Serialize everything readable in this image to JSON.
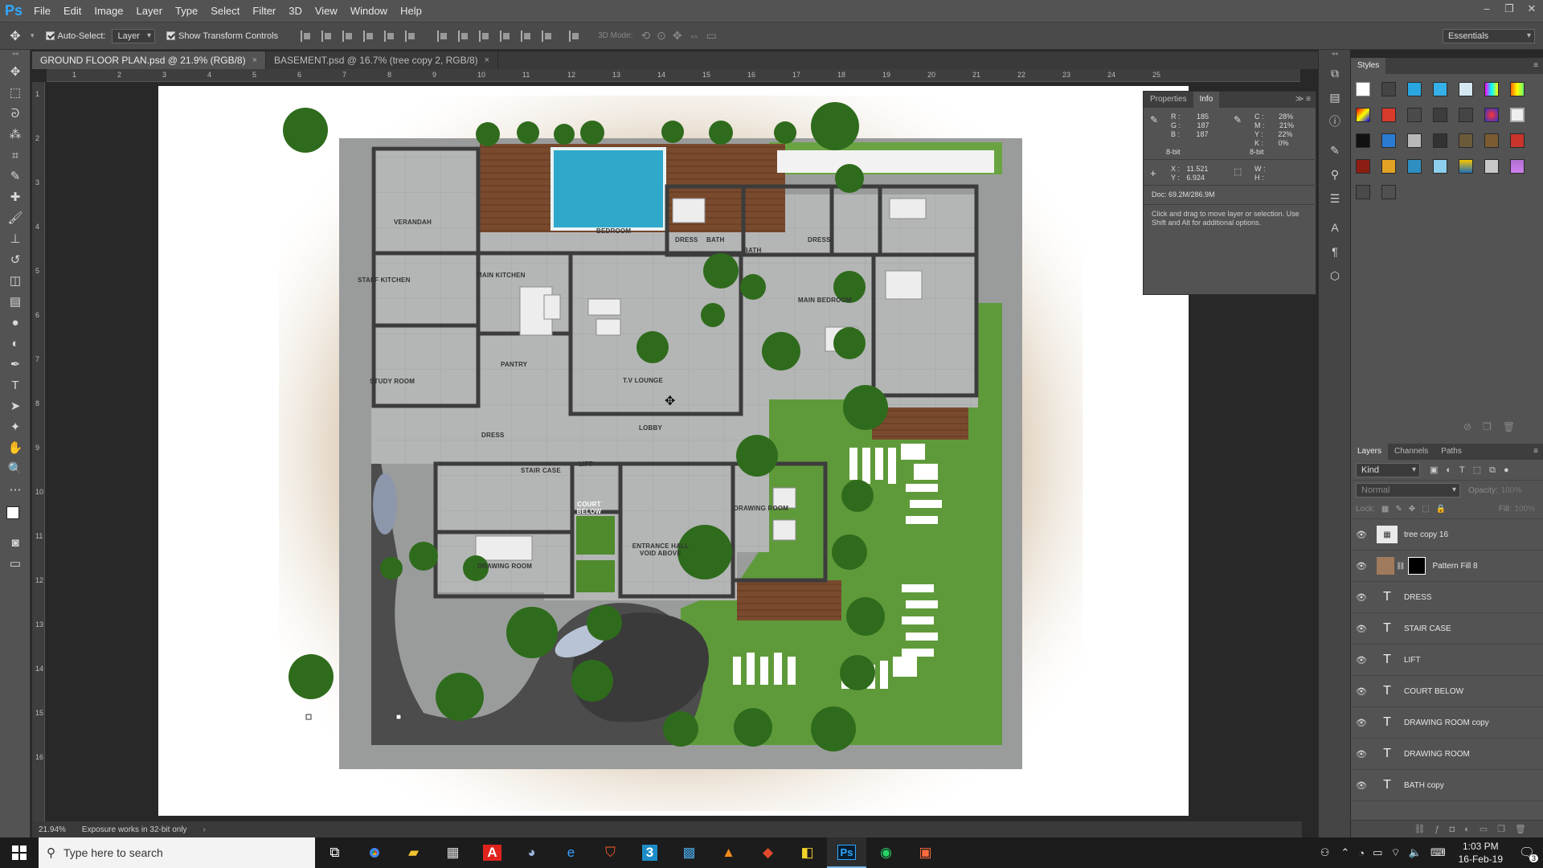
{
  "app": {
    "logo": "Ps"
  },
  "menu": [
    "File",
    "Edit",
    "Image",
    "Layer",
    "Type",
    "Select",
    "Filter",
    "3D",
    "View",
    "Window",
    "Help"
  ],
  "window_controls": {
    "minimize": "–",
    "restore": "❐",
    "close": "✕"
  },
  "options": {
    "auto_select_label": "Auto-Select:",
    "auto_select_value": "Layer",
    "show_transform_label": "Show Transform Controls",
    "mode_3d_label": "3D Mode:",
    "workspace": "Essentials"
  },
  "tabs": [
    {
      "label": "GROUND FLOOR PLAN.psd @ 21.9% (RGB/8)",
      "close": "×"
    },
    {
      "label": "BASEMENT.psd @ 16.7% (tree copy 2, RGB/8)",
      "close": "×"
    }
  ],
  "ruler_h": [
    "1",
    "2",
    "3",
    "4",
    "5",
    "6",
    "7",
    "8",
    "9",
    "10",
    "11",
    "12",
    "13",
    "14",
    "15",
    "16",
    "17",
    "18",
    "19",
    "20",
    "21",
    "22",
    "23",
    "24",
    "25"
  ],
  "ruler_v": [
    "1",
    "2",
    "3",
    "4",
    "5",
    "6",
    "7",
    "8",
    "9",
    "10",
    "11",
    "12",
    "13",
    "14",
    "15",
    "16"
  ],
  "plan_labels": {
    "verandah": "VERANDAH",
    "bedroom": "BEDROOM",
    "dress1": "DRESS",
    "bath1": "BATH",
    "bath2": "BATH",
    "dress2": "DRESS",
    "staff_kitchen": "STAFF KITCHEN",
    "main_kitchen": "MAIN KITCHEN",
    "main_bedroom": "MAIN BEDROOM",
    "pantry": "PANTRY",
    "study_room": "STUDY ROOM",
    "tv_lounge": "T.V LOUNGE",
    "lobby": "LOBBY",
    "dress3": "DRESS",
    "lift": "LIFT",
    "stair_case": "STAIR CASE",
    "court_below": "COURT BELOW",
    "drawing_room_right": "DRAWING ROOM",
    "entrance_hall": "ENTRANCE HALL VOID ABOVE",
    "drawing_room_left": "DRAWING ROOM"
  },
  "info_panel": {
    "tabs": [
      "Properties",
      "Info"
    ],
    "rgb": {
      "r_label": "R :",
      "r": "185",
      "g_label": "G :",
      "g": "187",
      "b_label": "B :",
      "b": "187"
    },
    "cmyk": {
      "c_label": "C :",
      "c": "28%",
      "m_label": "M :",
      "m": "21%",
      "y_label": "Y :",
      "y": "22%",
      "k_label": "K :",
      "k": "0%"
    },
    "bit_left": "8-bit",
    "bit_right": "8-bit",
    "x_label": "X :",
    "x": "11.521",
    "y_label": "Y :",
    "y": "6.924",
    "w_label": "W :",
    "h_label": "H :",
    "doc": "Doc: 69.2M/286.9M",
    "hint": "Click and drag to move layer or selection. Use Shift and Alt for additional options."
  },
  "styles_panel": {
    "title": "Styles"
  },
  "layers_panel": {
    "tabs": [
      "Layers",
      "Channels",
      "Paths"
    ],
    "kind": "Kind",
    "blend": "Normal",
    "opacity_label": "Opacity:",
    "opacity": "100%",
    "lock_label": "Lock:",
    "fill_label": "Fill:",
    "fill": "100%",
    "layers": [
      {
        "name": "tree copy 16",
        "type": "image"
      },
      {
        "name": "Pattern Fill 8",
        "type": "fill"
      },
      {
        "name": "DRESS",
        "type": "text"
      },
      {
        "name": "STAIR CASE",
        "type": "text"
      },
      {
        "name": "LIFT",
        "type": "text"
      },
      {
        "name": "COURT BELOW",
        "type": "text"
      },
      {
        "name": "DRAWING ROOM copy",
        "type": "text"
      },
      {
        "name": "DRAWING ROOM",
        "type": "text"
      },
      {
        "name": "BATH copy",
        "type": "text"
      }
    ]
  },
  "status": {
    "zoom": "21.94%",
    "message": "Exposure works in 32-bit only"
  },
  "taskbar": {
    "search_placeholder": "Type here to search",
    "time": "1:03 PM",
    "date": "16-Feb-19",
    "notification_count": "3"
  },
  "colors": {
    "accent": "#31a8ff",
    "panel": "#535353",
    "dark": "#282828",
    "pool": "#2fa8c9",
    "grass": "#5f9a3a",
    "deck": "#7a4a2e",
    "tree": "#2f6b1c"
  }
}
